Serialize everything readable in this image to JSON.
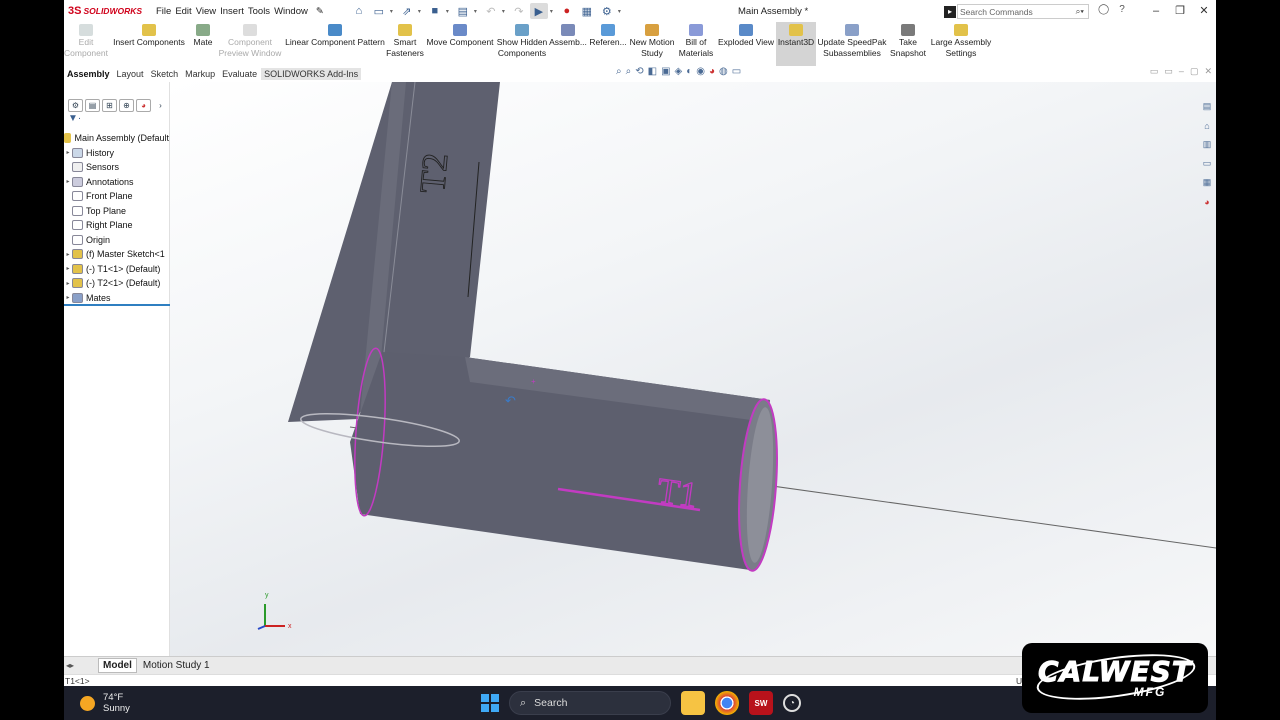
{
  "app": {
    "logo_text": "SOLIDWORKS",
    "document_title": "Main Assembly *",
    "menu": [
      "File",
      "Edit",
      "View",
      "Insert",
      "Tools",
      "Window"
    ],
    "search_placeholder": "Search Commands"
  },
  "ribbon": {
    "buttons": [
      {
        "label": "Edit\nComponent",
        "disabled": true
      },
      {
        "label": "Insert Components",
        "disabled": false
      },
      {
        "label": "Mate",
        "disabled": false
      },
      {
        "label": "Component\nPreview Window",
        "disabled": true
      },
      {
        "label": "Linear Component Pattern",
        "disabled": false
      },
      {
        "label": "Smart\nFasteners",
        "disabled": false
      },
      {
        "label": "Move Component",
        "disabled": false
      },
      {
        "label": "Show Hidden\nComponents",
        "disabled": false
      },
      {
        "label": "Assemb...",
        "disabled": false
      },
      {
        "label": "Referen...",
        "disabled": false
      },
      {
        "label": "New Motion\nStudy",
        "disabled": false
      },
      {
        "label": "Bill of\nMaterials",
        "disabled": false
      },
      {
        "label": "Exploded View",
        "disabled": false
      },
      {
        "label": "Instant3D",
        "disabled": false,
        "active": true
      },
      {
        "label": "Update SpeedPak\nSubassemblies",
        "disabled": false
      },
      {
        "label": "Take\nSnapshot",
        "disabled": false
      },
      {
        "label": "Large Assembly\nSettings",
        "disabled": false
      }
    ]
  },
  "command_tabs": [
    "Assembly",
    "Layout",
    "Sketch",
    "Markup",
    "Evaluate",
    "SOLIDWORKS Add-Ins"
  ],
  "tree": {
    "root": "Main Assembly (Default",
    "items": [
      {
        "label": "History",
        "expand": true
      },
      {
        "label": "Sensors",
        "expand": false
      },
      {
        "label": "Annotations",
        "expand": true
      },
      {
        "label": "Front Plane",
        "expand": false
      },
      {
        "label": "Top Plane",
        "expand": false
      },
      {
        "label": "Right Plane",
        "expand": false
      },
      {
        "label": "Origin",
        "expand": false
      },
      {
        "label": "(f) Master Sketch<1",
        "expand": true
      },
      {
        "label": "(-) T1<1> (Default)",
        "expand": true
      },
      {
        "label": "(-) T2<1> (Default)",
        "expand": true
      },
      {
        "label": "Mates",
        "expand": true
      }
    ]
  },
  "viewport": {
    "part_labels": {
      "t1": "T1",
      "t2": "T2"
    },
    "triad": {
      "x": "x",
      "y": "y"
    },
    "tube_color": "#5d5f6e",
    "edge_highlight": "#c23bc2"
  },
  "bottom_tabs": [
    "Model",
    "Motion Study 1"
  ],
  "status_text": "T1<1>",
  "status_right": "U",
  "taskbar": {
    "temp": "74°F",
    "condition": "Sunny",
    "search": "Search"
  },
  "brand": {
    "line1": "CALWEST",
    "line2": "MFG"
  }
}
